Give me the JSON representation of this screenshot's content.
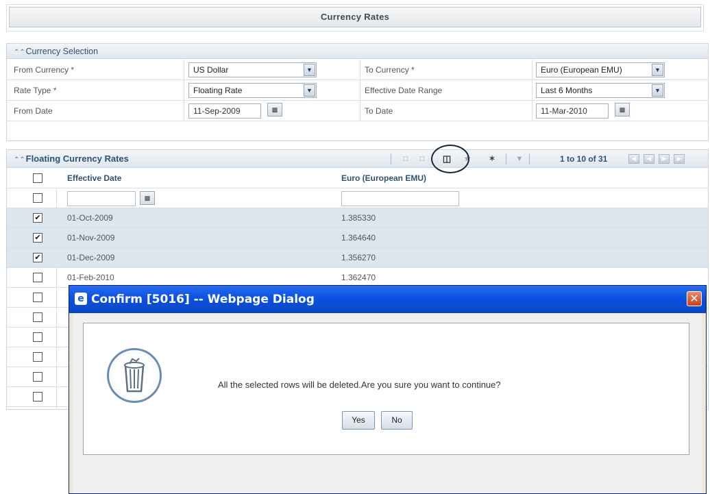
{
  "page": {
    "title": "Currency Rates"
  },
  "selection": {
    "header": "Currency Selection",
    "from_currency_label": "From Currency *",
    "from_currency_value": "US Dollar",
    "to_currency_label": "To Currency *",
    "to_currency_value": "Euro (European EMU)",
    "rate_type_label": "Rate Type *",
    "rate_type_value": "Floating Rate",
    "date_range_label": "Effective Date Range",
    "date_range_value": "Last 6 Months",
    "from_date_label": "From Date",
    "from_date_value": "11-Sep-2009",
    "to_date_label": "To Date",
    "to_date_value": "11-Mar-2010"
  },
  "grid": {
    "header": "Floating Currency Rates",
    "pager": "1 to 10 of 31",
    "col_date": "Effective Date",
    "col_rate": "Euro (European EMU)",
    "rows": [
      {
        "date": "01-Oct-2009",
        "rate": "1.385330",
        "checked": true
      },
      {
        "date": "01-Nov-2009",
        "rate": "1.364640",
        "checked": true
      },
      {
        "date": "01-Dec-2009",
        "rate": "1.356270",
        "checked": true
      },
      {
        "date": "01-Feb-2010",
        "rate": "1.362470",
        "checked": false
      }
    ]
  },
  "dialog": {
    "title": "Confirm [5016] -- Webpage Dialog",
    "message": "All the selected rows will be deleted.Are you sure you want to continue?",
    "yes": "Yes",
    "no": "No"
  },
  "icons": {
    "collapse": "collapse-arrow-icon",
    "calendar": "calendar-icon",
    "delete": "trash-icon",
    "dropdown": "chevron-down-icon"
  }
}
